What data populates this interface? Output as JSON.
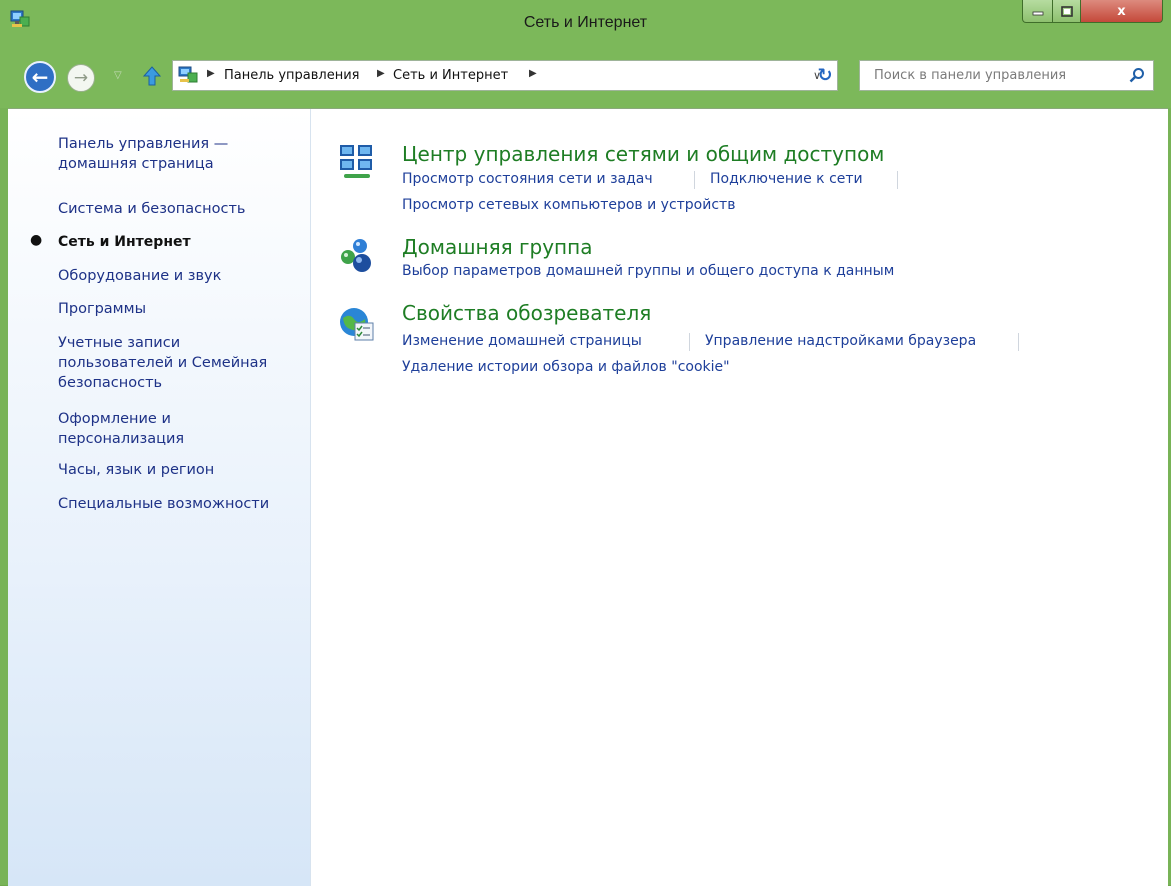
{
  "window": {
    "title": "Сеть и Интернет",
    "close_label": "x"
  },
  "navigation": {
    "breadcrumbs": [
      "Панель управления",
      "Сеть и Интернет"
    ],
    "search_placeholder": "Поиск в панели управления"
  },
  "sidebar": {
    "items": [
      {
        "label_line1": "Панель управления —",
        "label_line2": "домашняя страница"
      },
      {
        "label": "Система и безопасность"
      },
      {
        "label": "Сеть и Интернет",
        "current": true
      },
      {
        "label": "Оборудование и звук"
      },
      {
        "label": "Программы"
      },
      {
        "label_line1": "Учетные записи",
        "label_line2": "пользователей и Семейная",
        "label_line3": "безопасность"
      },
      {
        "label_line1": "Оформление и",
        "label_line2": "персонализация"
      },
      {
        "label": "Часы, язык и регион"
      },
      {
        "label": "Специальные возможности"
      }
    ]
  },
  "categories": [
    {
      "title": "Центр управления сетями и общим доступом",
      "icon": "network-center-icon",
      "links": [
        "Просмотр состояния сети и задач",
        "Подключение к сети",
        "Просмотр сетевых компьютеров и устройств"
      ]
    },
    {
      "title": "Домашняя группа",
      "icon": "homegroup-icon",
      "links": [
        "Выбор параметров домашней группы и общего доступа к данным"
      ]
    },
    {
      "title": "Свойства обозревателя",
      "icon": "internet-options-icon",
      "links": [
        "Изменение домашней страницы",
        "Управление надстройками браузера",
        "Удаление истории обзора и файлов \"cookie\""
      ]
    }
  ],
  "colors": {
    "frame_green": "#7cb85a",
    "link_blue": "#1e3f9a",
    "category_green": "#1e7d24"
  }
}
